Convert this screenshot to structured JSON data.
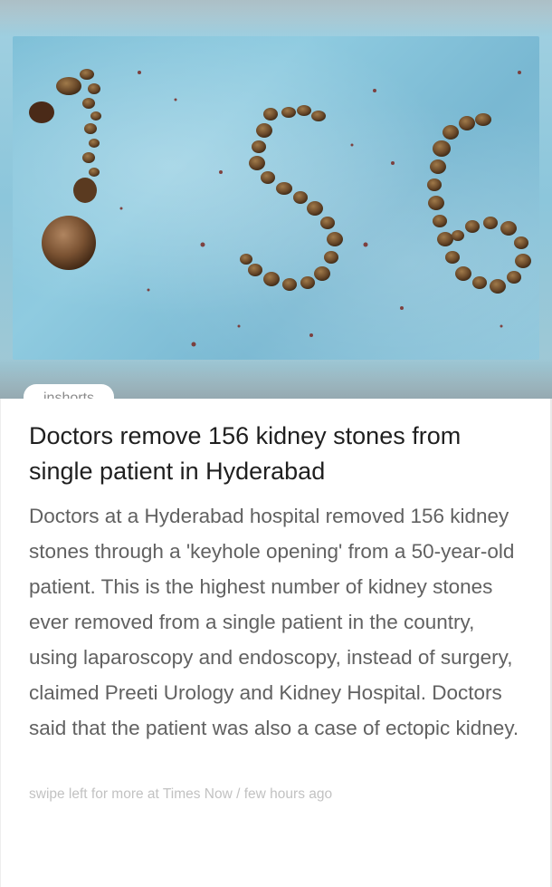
{
  "source": {
    "label": "inshorts"
  },
  "article": {
    "headline": "Doctors remove 156 kidney stones from single patient in Hyderabad",
    "body": "Doctors at a Hyderabad hospital removed 156 kidney stones through a 'keyhole opening' from a 50-year-old patient. This is the highest number of kidney stones ever removed from a single patient in the country, using laparoscopy and endoscopy, instead of surgery, claimed Preeti Urology and Kidney Hospital. Doctors said that the patient was also a case of ectopic kidney."
  },
  "footer": {
    "more_link": "swipe left for more at Times Now",
    "separator": " / ",
    "time": "few hours ago"
  },
  "colors": {
    "headline": "#1f1f1f",
    "body": "#616161",
    "footer": "#c2c2c2",
    "photo_background": "#8cc6db"
  }
}
